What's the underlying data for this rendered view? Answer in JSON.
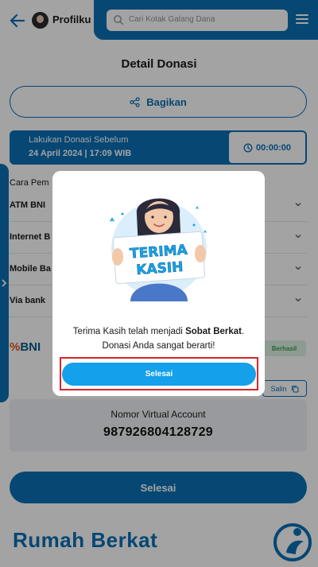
{
  "header": {
    "profile_label": "Profilku",
    "search_placeholder": "Cari Kotak Galang Dana"
  },
  "page": {
    "title": "Detail Donasi",
    "share_label": "Bagikan"
  },
  "deadline": {
    "label": "Lakukan Donasi Sebelum",
    "date": "24 April 2024 | 17:09 WIB",
    "timer": "00:00:00"
  },
  "payment": {
    "section_label": "Cara Pem",
    "methods": [
      {
        "label": "ATM BNI"
      },
      {
        "label": "Internet B"
      },
      {
        "label": "Mobile Ba"
      },
      {
        "label": "Via bank"
      }
    ]
  },
  "bank": {
    "logo_text": "BNI",
    "status": "Berhasil",
    "copy_label": "Salin"
  },
  "virtual_account": {
    "label": "Nomor Virtual Account",
    "number": "987926804128729"
  },
  "footer": {
    "finish_label": "Selesai",
    "brand": "Rumah Berkat"
  },
  "modal": {
    "sign_line1": "TERIMA",
    "sign_line2": "KASIH",
    "message_prefix": "Terima Kasih telah menjadi ",
    "message_bold": "Sobat Berkat",
    "message_suffix": ".",
    "message_line2": "Donasi Anda sangat berarti!",
    "button_label": "Selesai"
  },
  "colors": {
    "primary": "#0a6fb5",
    "button_modal": "#14a0ea",
    "highlight": "#d9252a"
  }
}
